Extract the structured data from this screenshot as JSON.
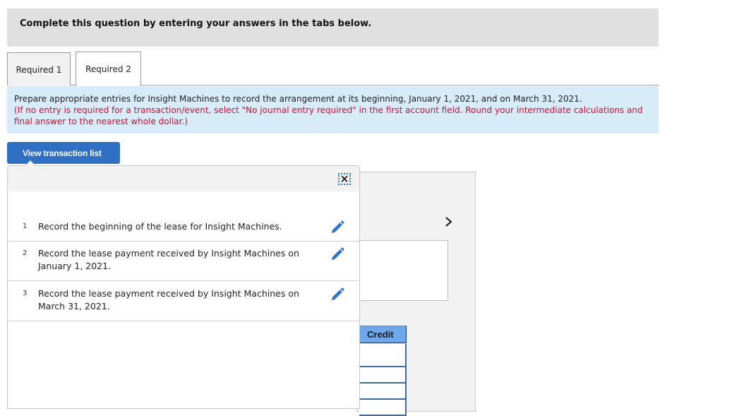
{
  "instruction_bar": {
    "text": "Complete this question by entering your answers in the tabs below."
  },
  "tabs": [
    {
      "label": "Required 1",
      "active": false
    },
    {
      "label": "Required 2",
      "active": true
    }
  ],
  "prompt": {
    "main": "Prepare appropriate entries for Insight Machines to record the arrangement at its beginning, January 1, 2021, and on March 31, 2021.",
    "note": "(If no entry is required for a transaction/event, select \"No journal entry required\" in the first account field. Round your intermediate calculations and final answer to the nearest whole dollar.)"
  },
  "view_transaction_button": {
    "label": "View transaction list"
  },
  "transaction_popover": {
    "close_icon": "close-icon",
    "items": [
      {
        "num": "1",
        "text": "Record the beginning of the lease for Insight Machines.",
        "icon": "pencil-icon"
      },
      {
        "num": "2",
        "text": "Record the lease payment received by Insight Machines on January 1, 2021.",
        "icon": "pencil-icon"
      },
      {
        "num": "3",
        "text": "Record the lease payment received by Insight Machines on March 31, 2021.",
        "icon": "pencil-icon"
      }
    ]
  },
  "journal": {
    "next_icon": "chevron-right-icon",
    "credit_header": "Credit",
    "credit_cells": [
      "",
      "",
      "",
      ""
    ]
  },
  "colors": {
    "accent_blue": "#2f6fc4",
    "note_red": "#c8102e",
    "prompt_bg": "#d7ebf9",
    "credit_header_bg": "#6ea8ea"
  }
}
